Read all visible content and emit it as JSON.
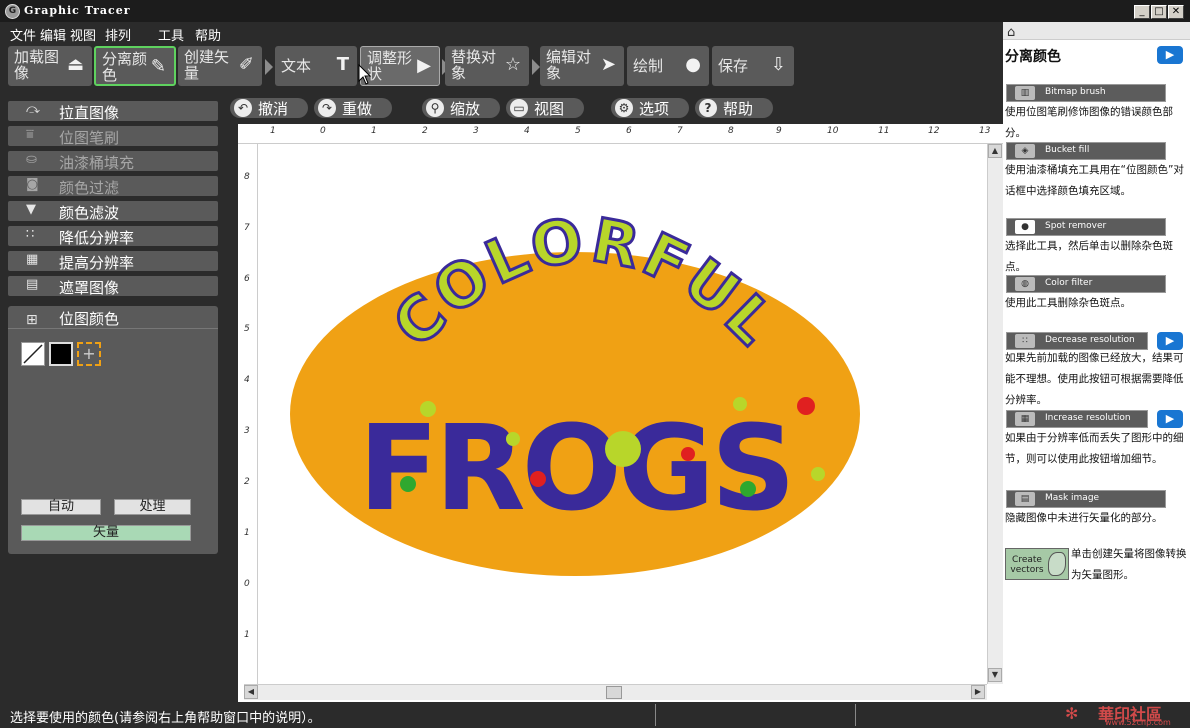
{
  "window": {
    "title": "Graphic Tracer",
    "app_icon_letter": "G",
    "minimize": "_",
    "maximize": "□",
    "close": "✕"
  },
  "menu": [
    "文件",
    "编辑",
    "视图",
    "排列",
    "工具",
    "帮助"
  ],
  "toolbar": [
    {
      "label": "加载图像",
      "icon": "load-icon",
      "glyph": "⏏"
    },
    {
      "label": "分离颜色",
      "icon": "eyedropper-icon",
      "glyph": "✎",
      "active": true
    },
    {
      "label": "创建矢量",
      "icon": "pen-icon",
      "glyph": "✐"
    },
    {
      "label": "文本",
      "icon": "text-icon",
      "glyph": "T"
    },
    {
      "label": "调整形状",
      "icon": "play-icon",
      "glyph": "▶"
    },
    {
      "label": "替换对象",
      "icon": "star-icon",
      "glyph": "☆"
    },
    {
      "label": "编辑对象",
      "icon": "cursor-icon",
      "glyph": "➤"
    },
    {
      "label": "绘制",
      "icon": "circle-icon",
      "glyph": "●"
    },
    {
      "label": "保存",
      "icon": "save-icon",
      "glyph": "⇩"
    }
  ],
  "sidebar": [
    {
      "label": "拉直图像",
      "icon": "straighten-icon",
      "glyph": "⤼",
      "enabled": true
    },
    {
      "label": "位图笔刷",
      "icon": "brush-icon",
      "glyph": "⩸",
      "enabled": false
    },
    {
      "label": "油漆桶填充",
      "icon": "bucket-icon",
      "glyph": "⛀",
      "enabled": false
    },
    {
      "label": "颜色过滤",
      "icon": "color-filter-icon",
      "glyph": "◙",
      "enabled": false
    },
    {
      "label": "颜色滤波",
      "icon": "funnel-icon",
      "glyph": "▼",
      "enabled": true
    },
    {
      "label": "降低分辨率",
      "icon": "decrease-res-icon",
      "glyph": "∷",
      "enabled": true
    },
    {
      "label": "提高分辨率",
      "icon": "increase-res-icon",
      "glyph": "▦",
      "enabled": true
    },
    {
      "label": "遮罩图像",
      "icon": "mask-icon",
      "glyph": "▤",
      "enabled": true
    }
  ],
  "panel": {
    "title": "位图颜色",
    "auto": "自动",
    "process": "处理",
    "vectorize": "矢量"
  },
  "topbar": [
    {
      "label": "撤消",
      "icon": "undo-icon",
      "glyph": "↶"
    },
    {
      "label": "重做",
      "icon": "redo-icon",
      "glyph": "↷"
    },
    {
      "label": "缩放",
      "icon": "zoom-icon",
      "glyph": "⚲"
    },
    {
      "label": "视图",
      "icon": "monitor-icon",
      "glyph": "▭"
    },
    {
      "label": "选项",
      "icon": "gear-icon",
      "glyph": "⚙"
    },
    {
      "label": "帮助",
      "icon": "help-icon",
      "glyph": "?"
    }
  ],
  "ruler": {
    "h": [
      "1",
      "0",
      "1",
      "2",
      "3",
      "4",
      "5",
      "6",
      "7",
      "8",
      "9",
      "10",
      "11",
      "12",
      "13"
    ],
    "v": [
      "8",
      "7",
      "6",
      "5",
      "4",
      "3",
      "2",
      "1",
      "0",
      "1"
    ]
  },
  "artwork": {
    "top_text": "COLORFUL",
    "bottom_text": "FROGS",
    "ellipse_color": "#f0a114",
    "top_text_color": "#b8d62a",
    "bottom_text_color": "#3a2a9a"
  },
  "status": "选择要使用的颜色(请参阅右上角帮助窗口中的说明）。",
  "watermark": {
    "brand": "華印社區",
    "url": "www.52cnp.com"
  },
  "help": {
    "title": "分离颜色",
    "items": [
      {
        "button": "Bitmap brush",
        "text": "使用位图笔刷修饰图像的错误颜色部分。",
        "play": false
      },
      {
        "button": "Bucket fill",
        "text": "使用油漆桶填充工具用在“位图颜色”对话框中选择颜色填充区域。",
        "play": false
      },
      {
        "button": "Spot remover",
        "text": "选择此工具，然后单击以删除杂色斑点。",
        "play": false
      },
      {
        "button": "Color filter",
        "text": "使用此工具删除杂色斑点。",
        "play": false
      },
      {
        "button": "Decrease resolution",
        "text": "如果先前加载的图像已经放大，结果可能不理想。使用此按钮可根据需要降低分辨率。",
        "play": true
      },
      {
        "button": "Increase resolution",
        "text": "如果由于分辨率低而丢失了图形中的细节，则可以使用此按钮增加细节。",
        "play": true
      },
      {
        "button": "Mask image",
        "text": "隐藏图像中未进行矢量化的部分。",
        "play": false
      }
    ],
    "create_vectors": "Create vectors",
    "create_vectors_text": "单击创建矢量将图像转换为矢量图形。"
  }
}
